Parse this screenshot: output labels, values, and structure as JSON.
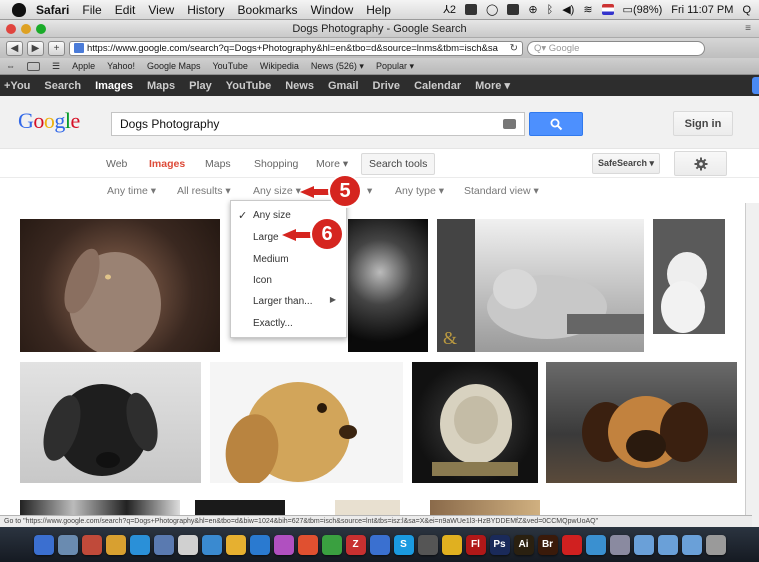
{
  "menubar": {
    "items": [
      "Safari",
      "File",
      "Edit",
      "View",
      "History",
      "Bookmarks",
      "Window",
      "Help"
    ],
    "status_badge": "2",
    "battery": "(98%)",
    "clock": "Fri 11:07 PM"
  },
  "window": {
    "title": "Dogs Photography - Google Search"
  },
  "toolbar": {
    "url": "https://www.google.com/search?q=Dogs+Photography&hl=en&tbo=d&source=lnms&tbm=isch&sa",
    "search_placeholder": "Q▾ Google"
  },
  "bookmarks": {
    "items": [
      "Apple",
      "Yahoo!",
      "Google Maps",
      "YouTube",
      "Wikipedia",
      "News (526) ▾",
      "Popular ▾"
    ]
  },
  "gbar": {
    "items": [
      "+You",
      "Search",
      "Images",
      "Maps",
      "Play",
      "YouTube",
      "News",
      "Gmail",
      "Drive",
      "Calendar",
      "More ▾"
    ]
  },
  "search": {
    "query": "Dogs Photography",
    "signin_label": "Sign in"
  },
  "tabs": {
    "web": "Web",
    "images": "Images",
    "maps": "Maps",
    "shopping": "Shopping",
    "more": "More ▾",
    "search_tools": "Search tools",
    "safesearch": "SafeSearch ▾"
  },
  "filters": {
    "any_time": "Any time ▾",
    "all_results": "All results ▾",
    "any_size": "Any size ▾",
    "any_type": "Any type ▾",
    "standard_view": "Standard view ▾"
  },
  "size_menu": {
    "items": [
      "Any size",
      "Large",
      "Medium",
      "Icon",
      "Larger than...",
      "Exactly..."
    ]
  },
  "callouts": {
    "five": "5",
    "six": "6"
  },
  "statusbar": {
    "text": "Go to \"https://www.google.com/search?q=Dogs+Photography&hl=en&tbo=d&biw=1024&bih=627&tbm=isch&source=lnt&tbs=isz:l&sa=X&ei=n9aWUe1l3-HzBYDDEMfZ&ved=0CCMQpwUoAQ\""
  },
  "colors": {
    "accent_red": "#dd4b39",
    "button_blue": "#4d90fe",
    "callout_red": "#d5251f",
    "gbar_bg": "#2d2d2d"
  }
}
